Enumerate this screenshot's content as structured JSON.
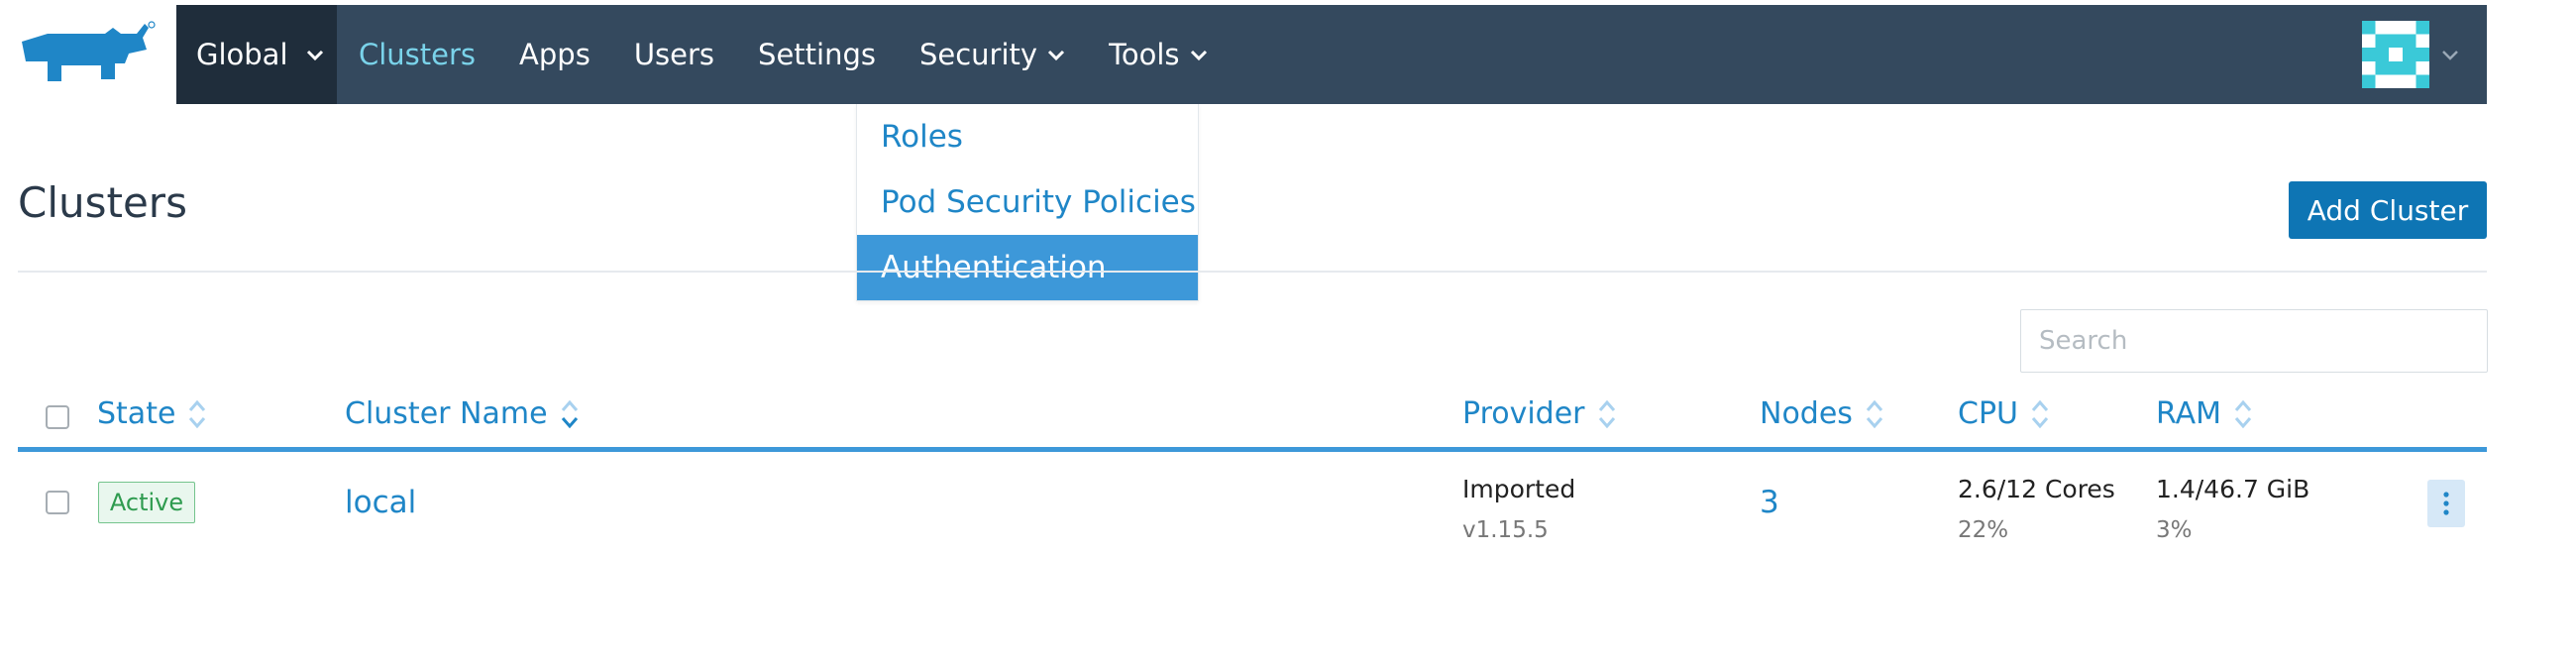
{
  "header": {
    "scope_label": "Global",
    "nav": [
      {
        "label": "Clusters",
        "active": true,
        "dropdown": false
      },
      {
        "label": "Apps",
        "active": false,
        "dropdown": false
      },
      {
        "label": "Users",
        "active": false,
        "dropdown": false
      },
      {
        "label": "Settings",
        "active": false,
        "dropdown": false
      },
      {
        "label": "Security",
        "active": false,
        "dropdown": true
      },
      {
        "label": "Tools",
        "active": false,
        "dropdown": true
      }
    ],
    "logo_icon": "rancher-cow-logo",
    "avatar_icon": "identicon-avatar"
  },
  "security_menu": {
    "items": [
      "Roles",
      "Pod Security Policies",
      "Authentication"
    ],
    "highlighted": "Authentication"
  },
  "page": {
    "title": "Clusters",
    "add_button": "Add Cluster",
    "search_placeholder": "Search"
  },
  "table": {
    "columns": [
      "State",
      "Cluster Name",
      "Provider",
      "Nodes",
      "CPU",
      "RAM"
    ],
    "rows": [
      {
        "state": "Active",
        "name": "local",
        "provider": "Imported",
        "provider_version": "v1.15.5",
        "nodes": "3",
        "cpu": "2.6/12 Cores",
        "cpu_pct": "22%",
        "ram": "1.4/46.7 GiB",
        "ram_pct": "3%"
      }
    ]
  },
  "colors": {
    "navbar": "#34495e",
    "navbar_scope": "#1f2d3b",
    "link": "#1f86c7",
    "primary_button": "#0e75b4",
    "active_badge": "#2e9b4f",
    "highlight": "#3d98d9"
  }
}
